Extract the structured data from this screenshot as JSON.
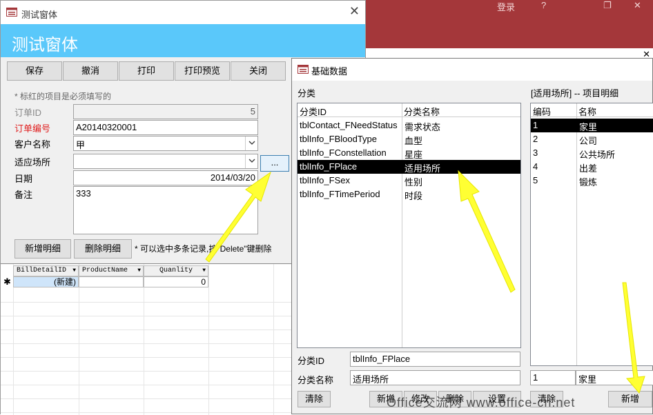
{
  "background": {
    "account_label": "登录",
    "help_label": "?",
    "restore_label": "❐",
    "close_label": "✕",
    "strip_close": "✕"
  },
  "main_window": {
    "title": "测试窗体",
    "header": "测试窗体",
    "close_label": "✕",
    "buttons": [
      "保存",
      "撤消",
      "打印",
      "打印预览",
      "关闭"
    ],
    "note": "* 标红的项目是必须填写的",
    "fields": {
      "order_id_label": "订单ID",
      "order_id_value": "5",
      "order_no_label": "订单编号",
      "order_no_value": "A20140320001",
      "customer_label": "客户名称",
      "customer_value": "甲",
      "place_label": "适应场所",
      "place_value": "",
      "date_label": "日期",
      "date_value": "2014/03/20",
      "remark_label": "备注",
      "remark_value": "333"
    },
    "more_button": "...",
    "add_detail_button": "新增明细",
    "delete_detail_button": "删除明细",
    "delete_hint": "* 可以选中多条记录,按\"Delete\"键删除",
    "subgrid": {
      "columns": [
        "BillDetailID",
        "ProductName",
        "Quanlity"
      ],
      "new_row_marker": "✱",
      "new_row": {
        "id": "(新建)",
        "product": "",
        "qty": "0"
      }
    }
  },
  "base_window": {
    "title": "基础数据",
    "category_section": "分类",
    "detail_section": "[适用场所] -- 项目明细",
    "category_columns": [
      "分类ID",
      "分类名称"
    ],
    "categories": [
      {
        "id": "tblContact_FNeedStatus",
        "name": "需求状态"
      },
      {
        "id": "tblInfo_FBloodType",
        "name": "血型"
      },
      {
        "id": "tblInfo_FConstellation",
        "name": "星座"
      },
      {
        "id": "tblInfo_FPlace",
        "name": "适用场所"
      },
      {
        "id": "tblInfo_FSex",
        "name": "性别"
      },
      {
        "id": "tblInfo_FTimePeriod",
        "name": "时段"
      }
    ],
    "detail_columns": [
      "编码",
      "名称"
    ],
    "details": [
      {
        "code": "1",
        "name": "家里"
      },
      {
        "code": "2",
        "name": "公司"
      },
      {
        "code": "3",
        "name": "公共场所"
      },
      {
        "code": "4",
        "name": "出差"
      },
      {
        "code": "5",
        "name": "锻炼"
      }
    ],
    "category_id_label": "分类ID",
    "category_id_value": "tblInfo_FPlace",
    "category_name_label": "分类名称",
    "category_name_value": "适用场所",
    "detail_code_value": "1",
    "detail_name_value": "家里",
    "buttons": {
      "clear": "清除",
      "add": "新增",
      "modify": "修改",
      "delete": "删除",
      "setup": "设置",
      "clear2": "清除",
      "add2": "新增"
    }
  },
  "watermark": "Office交流网 www.office-cn.net",
  "colors": {
    "header_blue": "#5ac8fa",
    "bg_red": "#a4373a",
    "required_red": "#e02020",
    "arrow_yellow": "#ffff33"
  }
}
